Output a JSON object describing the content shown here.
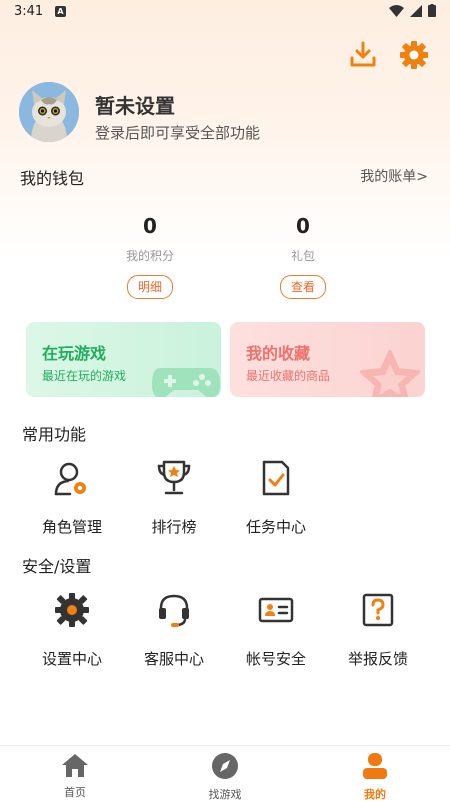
{
  "status_bar": {
    "time": "3:41",
    "notification_badge": "A"
  },
  "header": {
    "download_icon": "download-icon",
    "settings_icon": "gear-icon"
  },
  "profile": {
    "name": "暂未设置",
    "subtitle": "登录后即可享受全部功能"
  },
  "wallet": {
    "title": "我的钱包",
    "link": "我的账单>",
    "stats": [
      {
        "value": "0",
        "label": "我的积分",
        "button": "明细"
      },
      {
        "value": "0",
        "label": "礼包",
        "button": "查看"
      }
    ]
  },
  "cards": [
    {
      "title": "在玩游戏",
      "subtitle": "最近在玩的游戏",
      "color": "#1fae5b"
    },
    {
      "title": "我的收藏",
      "subtitle": "最近收藏的商品",
      "color": "#f0716a"
    }
  ],
  "common": {
    "title": "常用功能",
    "items": [
      {
        "label": "角色管理",
        "icon": "user-gear-icon"
      },
      {
        "label": "排行榜",
        "icon": "trophy-icon"
      },
      {
        "label": "任务中心",
        "icon": "task-icon"
      }
    ]
  },
  "security": {
    "title": "安全/设置",
    "items": [
      {
        "label": "设置中心",
        "icon": "gear-icon"
      },
      {
        "label": "客服中心",
        "icon": "headset-icon"
      },
      {
        "label": "帐号安全",
        "icon": "id-card-icon"
      },
      {
        "label": "举报反馈",
        "icon": "question-icon"
      }
    ]
  },
  "navbar": {
    "items": [
      {
        "label": "首页",
        "icon": "home-icon"
      },
      {
        "label": "找游戏",
        "icon": "compass-icon"
      },
      {
        "label": "我的",
        "icon": "person-icon",
        "active": true
      }
    ],
    "active_color": "#f07a10"
  },
  "colors": {
    "accent": "#f0800f"
  }
}
